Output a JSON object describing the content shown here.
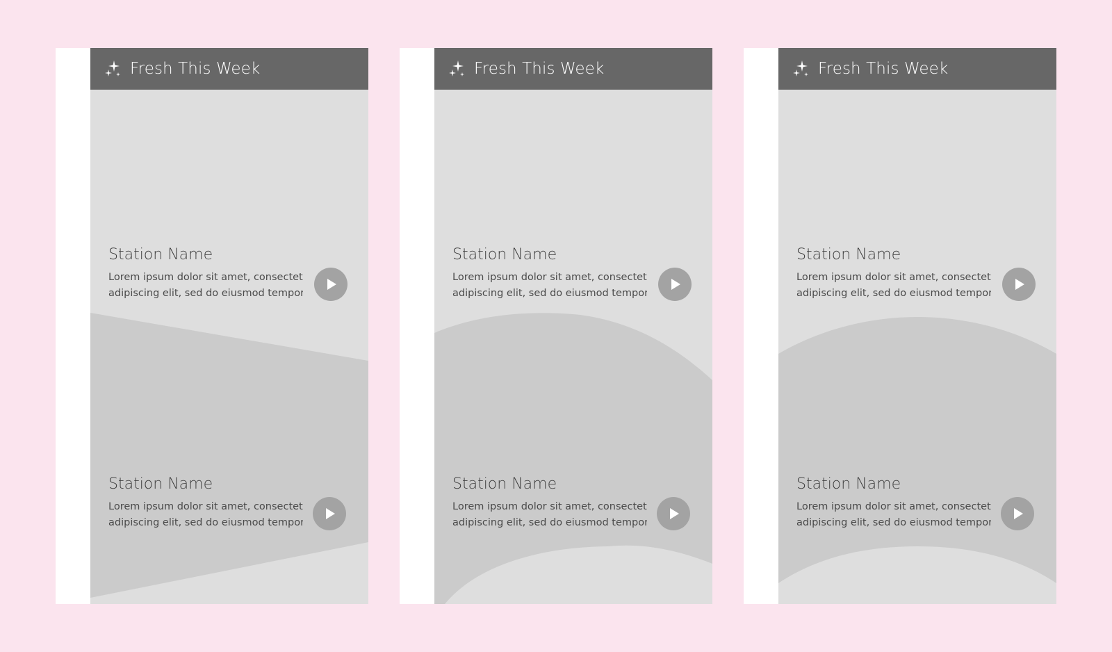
{
  "cards": [
    {
      "variant": "diagonal",
      "header": {
        "icon": "sparkles-icon",
        "title": "Fresh This Week"
      },
      "stations": [
        {
          "name": "Station Name",
          "desc_line1": "Lorem ipsum dolor sit amet, consectetur",
          "desc_line2": "adipiscing elit, sed do eiusmod tempor...",
          "play_icon": "play-icon"
        },
        {
          "name": "Station Name",
          "desc_line1": "Lorem ipsum dolor sit amet, consectetur",
          "desc_line2": "adipiscing elit, sed do eiusmod tempor...",
          "play_icon": "play-icon"
        }
      ]
    },
    {
      "variant": "curve-skewed",
      "header": {
        "icon": "sparkles-icon",
        "title": "Fresh This Week"
      },
      "stations": [
        {
          "name": "Station Name",
          "desc_line1": "Lorem ipsum dolor sit amet, consectetur",
          "desc_line2": "adipiscing elit, sed do eiusmod tempor...",
          "play_icon": "play-icon"
        },
        {
          "name": "Station Name",
          "desc_line1": "Lorem ipsum dolor sit amet, consectetur",
          "desc_line2": "adipiscing elit, sed do eiusmod tempor...",
          "play_icon": "play-icon"
        }
      ]
    },
    {
      "variant": "curve-centered",
      "header": {
        "icon": "sparkles-icon",
        "title": "Fresh This Week"
      },
      "stations": [
        {
          "name": "Station Name",
          "desc_line1": "Lorem ipsum dolor sit amet, consectetur",
          "desc_line2": "adipiscing elit, sed do eiusmod tempor...",
          "play_icon": "play-icon"
        },
        {
          "name": "Station Name",
          "desc_line1": "Lorem ipsum dolor sit amet, consectetur",
          "desc_line2": "adipiscing elit, sed do eiusmod tempor...",
          "play_icon": "play-icon"
        }
      ]
    }
  ],
  "colors": {
    "page_background": "#fbe4ee",
    "card_background": "#ffffff",
    "header_background": "#676767",
    "panel_light": "#dedede",
    "panel_dark": "#cbcbcb",
    "play_button": "#a3a3a3"
  }
}
